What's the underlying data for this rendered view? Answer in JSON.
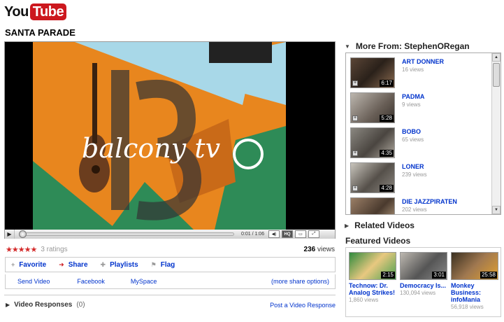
{
  "logo": {
    "you": "You",
    "tube": "Tube"
  },
  "video": {
    "title": "SANTA PARADE",
    "time": "0:01 / 1:06",
    "seek_fraction": 0.01,
    "screen_text": "balcony tv"
  },
  "controls": {
    "play": "▶",
    "hq": "HQ",
    "volume": "◀)"
  },
  "rating": {
    "stars": "★★★★★",
    "count": "3 ratings"
  },
  "views": {
    "count": "236",
    "label": "views"
  },
  "actions": [
    {
      "label": "Favorite",
      "glyph": "+"
    },
    {
      "label": "Share",
      "glyph": "➜"
    },
    {
      "label": "Playlists",
      "glyph": "✚"
    },
    {
      "label": "Flag",
      "glyph": "⚑"
    }
  ],
  "share_links": {
    "send": "Send Video",
    "facebook": "Facebook",
    "myspace": "MySpace",
    "more": "(more share options)"
  },
  "responses": {
    "label": "Video Responses",
    "count": "(0)",
    "post": "Post a Video Response"
  },
  "more_from": {
    "title": "More From: StephenORegan",
    "items": [
      {
        "title": "ART DONNER",
        "views": "16 views",
        "duration": "6:17"
      },
      {
        "title": "PADMA",
        "views": "9 views",
        "duration": "5:28"
      },
      {
        "title": "BOBO",
        "views": "65 views",
        "duration": "4:35"
      },
      {
        "title": "LONER",
        "views": "239 views",
        "duration": "4:28"
      },
      {
        "title": "DIE JAZZPIRATEN",
        "views": "202 views",
        "duration": ""
      }
    ]
  },
  "related": {
    "title": "Related Videos"
  },
  "featured": {
    "title": "Featured Videos",
    "items": [
      {
        "title": "Technow: Dr. Analog Strikes!",
        "views": "1,860 views",
        "duration": "2:15"
      },
      {
        "title": "Democracy Is...",
        "views": "130,094 views",
        "duration": "3:01"
      },
      {
        "title": "Monkey Business: infoMania",
        "views": "56,918 views",
        "duration": "25:58"
      }
    ]
  },
  "colors": {
    "accent_red": "#cc181e",
    "link_blue": "#0033cc",
    "orange": "#e8861e",
    "green": "#2e8b57",
    "sky": "#a8d8e8"
  }
}
